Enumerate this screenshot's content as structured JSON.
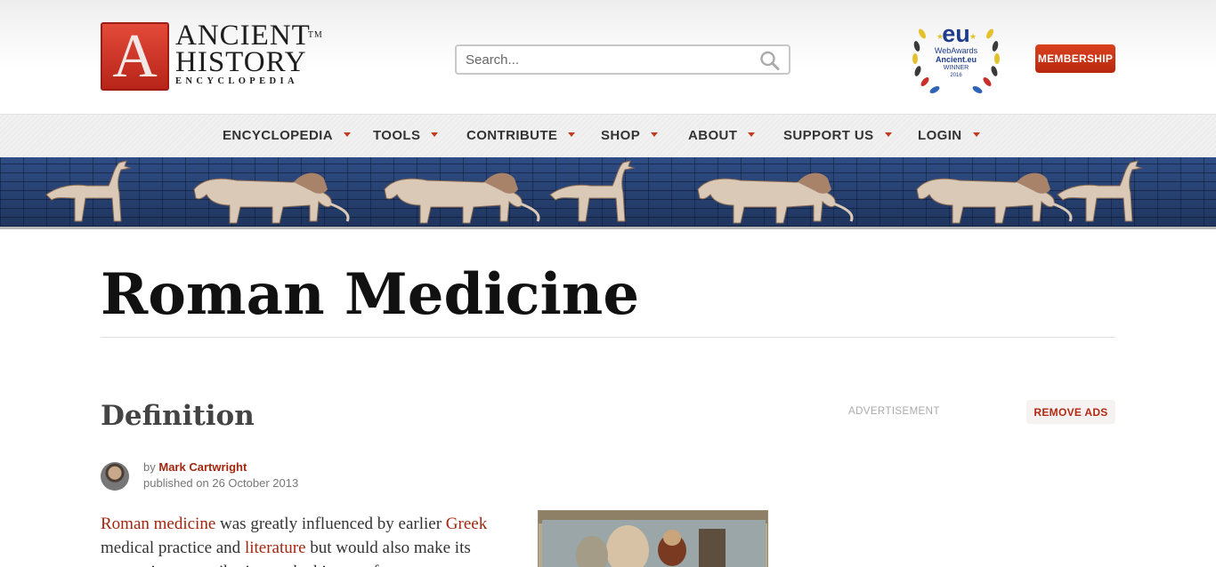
{
  "header": {
    "logo_line1": "ANCIENT",
    "logo_line2": "HISTORY",
    "logo_line3": "ENCYCLOPEDIA",
    "logo_letter": "A",
    "logo_tm": "TM",
    "search_placeholder": "Search...",
    "award": {
      "eu": "eu",
      "line1": "WebAwards",
      "line2": "Ancient.eu",
      "line3": "WINNER",
      "year": "2016"
    },
    "membership_label": "MEMBERSHIP"
  },
  "nav": {
    "items": [
      {
        "label": "ENCYCLOPEDIA"
      },
      {
        "label": "TOOLS"
      },
      {
        "label": "CONTRIBUTE"
      },
      {
        "label": "SHOP"
      },
      {
        "label": "ABOUT"
      },
      {
        "label": "SUPPORT US"
      },
      {
        "label": "LOGIN"
      }
    ]
  },
  "page": {
    "title": "Roman Medicine",
    "section": "Definition",
    "advertisement_label": "ADVERTISEMENT",
    "remove_ads_label": "REMOVE ADS",
    "by_label": "by",
    "author": "Mark Cartwright",
    "published": "published on 26 October 2013",
    "body": {
      "link1": "Roman medicine",
      "text1": " was greatly influenced by earlier ",
      "link2": "Greek",
      "text2": " medical practice and ",
      "link3": "literature",
      "text3": " but would also make its own unique contribution to the history of"
    }
  },
  "colors": {
    "accent": "#a3270f",
    "membership": "#c8351a",
    "banner": "#25406f"
  }
}
